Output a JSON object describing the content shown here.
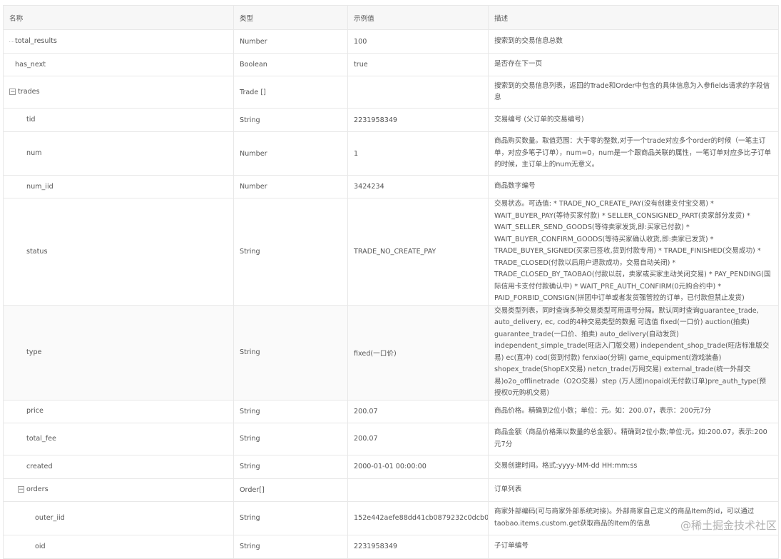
{
  "table": {
    "headers": {
      "name": "名称",
      "type": "类型",
      "example": "示例值",
      "desc": "描述"
    },
    "rows": [
      {
        "name": "total_results",
        "type": "Number",
        "example": "100",
        "desc": "搜索到的交易信息总数"
      },
      {
        "name": "has_next",
        "type": "Boolean",
        "example": "true",
        "desc": "是否存在下一页"
      },
      {
        "name": "trades",
        "type": "Trade []",
        "example": "",
        "desc": "搜索到的交易信息列表，返回的Trade和Order中包含的具体信息为入参fields请求的字段信息"
      },
      {
        "name": "tid",
        "type": "String",
        "example": "2231958349",
        "desc": "交易编号 (父订单的交易编号)"
      },
      {
        "name": "num",
        "type": "Number",
        "example": "1",
        "desc": "商品购买数量。取值范围：大于零的整数,对于一个trade对应多个order的时候（一笔主订单，对应多笔子订单），num=0，num是一个跟商品关联的属性，一笔订单对应多比子订单的时候，主订单上的num无意义。"
      },
      {
        "name": "num_iid",
        "type": "Number",
        "example": "3424234",
        "desc": "商品数字编号"
      },
      {
        "name": "status",
        "type": "String",
        "example": "TRADE_NO_CREATE_PAY",
        "desc": "交易状态。可选值: * TRADE_NO_CREATE_PAY(没有创建支付宝交易) * WAIT_BUYER_PAY(等待买家付款) * SELLER_CONSIGNED_PART(卖家部分发货) * WAIT_SELLER_SEND_GOODS(等待卖家发货,即:买家已付款) * WAIT_BUYER_CONFIRM_GOODS(等待买家确认收货,即:卖家已发货) * TRADE_BUYER_SIGNED(买家已签收,货到付款专用) * TRADE_FINISHED(交易成功) * TRADE_CLOSED(付款以后用户退款成功，交易自动关闭) * TRADE_CLOSED_BY_TAOBAO(付款以前，卖家或买家主动关闭交易) * PAY_PENDING(国际信用卡支付付款确认中) * WAIT_PRE_AUTH_CONFIRM(0元购合约中) * PAID_FORBID_CONSIGN(拼团中订单或者发货强管控的订单，已付款但禁止发货)"
      },
      {
        "name": "type",
        "type": "String",
        "example": "fixed(一口价)",
        "desc": "交易类型列表，同时查询多种交易类型可用逗号分隔。默认同时查询guarantee_trade, auto_delivery, ec, cod的4种交易类型的数据 可选值 fixed(一口价) auction(拍卖) guarantee_trade(一口价、拍卖) auto_delivery(自动发货) independent_simple_trade(旺店入门版交易) independent_shop_trade(旺店标准版交易) ec(直冲) cod(货到付款) fenxiao(分销) game_equipment(游戏装备) shopex_trade(ShopEX交易) netcn_trade(万网交易) external_trade(统一外部交易)o2o_offlinetrade（O2O交易）step (万人团)nopaid(无付款订单)pre_auth_type(预授权0元购机交易)"
      },
      {
        "name": "price",
        "type": "String",
        "example": "200.07",
        "desc": "商品价格。精确到2位小数；单位：元。如：200.07，表示：200元7分"
      },
      {
        "name": "total_fee",
        "type": "String",
        "example": "200.07",
        "desc": "商品金额（商品价格乘以数量的总金额）。精确到2位小数;单位:元。如:200.07，表示:200元7分"
      },
      {
        "name": "created",
        "type": "String",
        "example": "2000-01-01 00:00:00",
        "desc": "交易创建时间。格式:yyyy-MM-dd HH:mm:ss"
      },
      {
        "name": "orders",
        "type": "Order[]",
        "example": "",
        "desc": "订单列表"
      },
      {
        "name": "outer_iid",
        "type": "String",
        "example": "152e442aefe88dd41cb0879232c0dcb0",
        "desc": "商家外部编码(可与商家外部系统对接)。外部商家自己定义的商品Item的id，可以通过taobao.items.custom.get获取商品的Item的信息"
      },
      {
        "name": "oid",
        "type": "String",
        "example": "2231958349",
        "desc": "子订单编号"
      }
    ]
  },
  "watermark": "@稀土掘金技术社区"
}
